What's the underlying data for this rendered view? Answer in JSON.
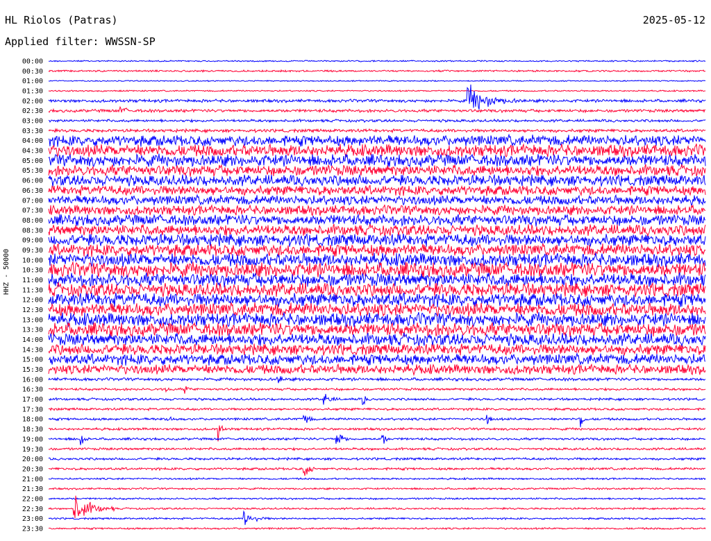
{
  "header": {
    "station": "HL Riolos (Patras)",
    "date": "2025-05-12",
    "filter_label": "Applied filter: WWSSN-SP"
  },
  "chart_data": {
    "type": "line",
    "title": "HL Riolos (Patras)",
    "ylabel": "HHZ - 50000",
    "xlabel": "",
    "grid": false,
    "colors": {
      "even_row": "#0000ff",
      "odd_row": "#ff0033"
    },
    "rows": [
      {
        "label": "00:00",
        "amp": 1.2
      },
      {
        "label": "00:30",
        "amp": 1.5
      },
      {
        "label": "01:00",
        "amp": 1.0
      },
      {
        "label": "01:30",
        "amp": 1.2
      },
      {
        "label": "02:00",
        "amp": 2.5
      },
      {
        "label": "02:30",
        "amp": 2.5
      },
      {
        "label": "03:00",
        "amp": 2.2
      },
      {
        "label": "03:30",
        "amp": 2.6
      },
      {
        "label": "04:00",
        "amp": 9
      },
      {
        "label": "04:30",
        "amp": 10
      },
      {
        "label": "05:00",
        "amp": 10
      },
      {
        "label": "05:30",
        "amp": 9
      },
      {
        "label": "06:00",
        "amp": 9
      },
      {
        "label": "06:30",
        "amp": 8
      },
      {
        "label": "07:00",
        "amp": 8
      },
      {
        "label": "07:30",
        "amp": 8
      },
      {
        "label": "08:00",
        "amp": 9
      },
      {
        "label": "08:30",
        "amp": 9
      },
      {
        "label": "09:00",
        "amp": 10
      },
      {
        "label": "09:30",
        "amp": 10
      },
      {
        "label": "10:00",
        "amp": 11
      },
      {
        "label": "10:30",
        "amp": 12
      },
      {
        "label": "11:00",
        "amp": 11
      },
      {
        "label": "11:30",
        "amp": 11
      },
      {
        "label": "12:00",
        "amp": 11
      },
      {
        "label": "12:30",
        "amp": 11
      },
      {
        "label": "13:00",
        "amp": 11
      },
      {
        "label": "13:30",
        "amp": 11
      },
      {
        "label": "14:00",
        "amp": 10
      },
      {
        "label": "14:30",
        "amp": 9
      },
      {
        "label": "15:00",
        "amp": 9
      },
      {
        "label": "15:30",
        "amp": 8
      },
      {
        "label": "16:00",
        "amp": 2.5
      },
      {
        "label": "16:30",
        "amp": 2
      },
      {
        "label": "17:00",
        "amp": 2
      },
      {
        "label": "17:30",
        "amp": 2
      },
      {
        "label": "18:00",
        "amp": 2
      },
      {
        "label": "18:30",
        "amp": 2
      },
      {
        "label": "19:00",
        "amp": 2
      },
      {
        "label": "19:30",
        "amp": 2
      },
      {
        "label": "20:00",
        "amp": 2
      },
      {
        "label": "20:30",
        "amp": 2
      },
      {
        "label": "21:00",
        "amp": 1.5
      },
      {
        "label": "21:30",
        "amp": 1.5
      },
      {
        "label": "22:00",
        "amp": 1.5
      },
      {
        "label": "22:30",
        "amp": 1.5
      },
      {
        "label": "23:00",
        "amp": 1.5
      },
      {
        "label": "23:30",
        "amp": 1.5
      }
    ],
    "events": [
      {
        "row": "02:00",
        "x": 0.64,
        "amp": 26,
        "len": 0.08
      },
      {
        "row": "02:30",
        "x": 0.11,
        "amp": 7,
        "len": 0.05
      },
      {
        "row": "16:00",
        "x": 0.35,
        "amp": 9,
        "len": 0.02
      },
      {
        "row": "16:30",
        "x": 0.18,
        "amp": 9,
        "len": 0.01
      },
      {
        "row": "16:30",
        "x": 0.21,
        "amp": 9,
        "len": 0.01
      },
      {
        "row": "17:00",
        "x": 0.42,
        "amp": 12,
        "len": 0.03
      },
      {
        "row": "17:00",
        "x": 0.48,
        "amp": 12,
        "len": 0.01
      },
      {
        "row": "18:00",
        "x": 0.39,
        "amp": 12,
        "len": 0.02
      },
      {
        "row": "18:00",
        "x": 0.18,
        "amp": 6,
        "len": 0.03
      },
      {
        "row": "18:00",
        "x": 0.67,
        "amp": 12,
        "len": 0.01
      },
      {
        "row": "18:00",
        "x": 0.81,
        "amp": 18,
        "len": 0.01
      },
      {
        "row": "18:30",
        "x": 0.26,
        "amp": 20,
        "len": 0.01
      },
      {
        "row": "19:00",
        "x": 0.05,
        "amp": 16,
        "len": 0.01
      },
      {
        "row": "19:00",
        "x": 0.44,
        "amp": 18,
        "len": 0.02
      },
      {
        "row": "19:00",
        "x": 0.51,
        "amp": 14,
        "len": 0.01
      },
      {
        "row": "20:30",
        "x": 0.39,
        "amp": 12,
        "len": 0.03
      },
      {
        "row": "22:30",
        "x": 0.04,
        "amp": 26,
        "len": 0.06
      },
      {
        "row": "23:00",
        "x": 0.3,
        "amp": 14,
        "len": 0.04
      }
    ]
  }
}
